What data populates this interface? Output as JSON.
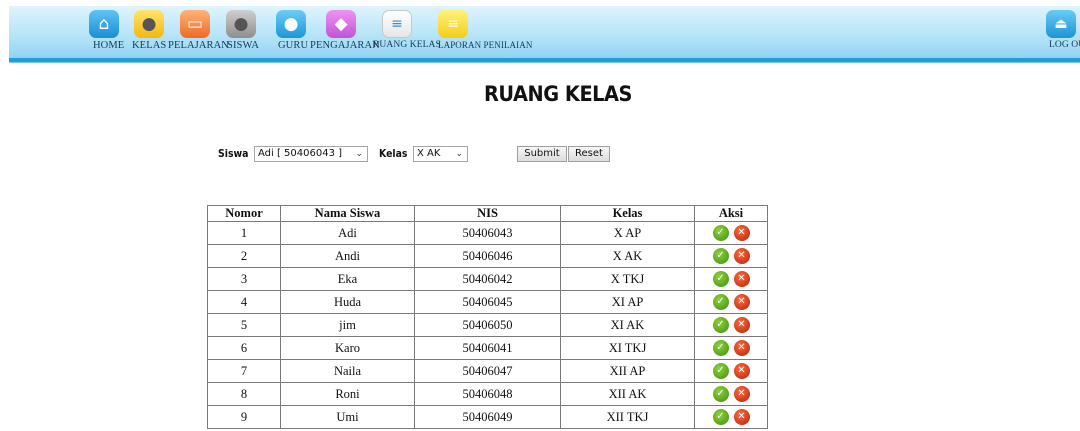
{
  "nav": {
    "items": [
      {
        "label": "HOME",
        "icon": "home-icon"
      },
      {
        "label": "KELAS",
        "icon": "user-icon"
      },
      {
        "label": "PELAJARAN",
        "icon": "book-icon"
      },
      {
        "label": "SISWA",
        "icon": "user-icon"
      },
      {
        "label": "GURU",
        "icon": "user-icon"
      },
      {
        "label": "PENGAJARAN",
        "icon": "graduation-cap-icon"
      },
      {
        "label": "RUANG KELAS",
        "icon": "list-icon"
      },
      {
        "label": "LAPORAN PENILAIAN",
        "icon": "notepad-icon"
      }
    ],
    "logout_label": "LOG OUT"
  },
  "page": {
    "title": "RUANG KELAS"
  },
  "filter": {
    "siswa_label": "Siswa",
    "siswa_value": "Adi [ 50406043 ]",
    "kelas_label": "Kelas",
    "kelas_value": "X AK",
    "submit_label": "Submit",
    "reset_label": "Reset"
  },
  "table": {
    "headers": [
      "Nomor",
      "Nama Siswa",
      "NIS",
      "Kelas",
      "Aksi"
    ],
    "rows": [
      [
        "1",
        "Adi",
        "50406043",
        "X AP"
      ],
      [
        "2",
        "Andi",
        "50406046",
        "X AK"
      ],
      [
        "3",
        "Eka",
        "50406042",
        "X TKJ"
      ],
      [
        "4",
        "Huda",
        "50406045",
        "XI AP"
      ],
      [
        "5",
        "jim",
        "50406050",
        "XI AK"
      ],
      [
        "6",
        "Karo",
        "50406041",
        "XI TKJ"
      ],
      [
        "7",
        "Naila",
        "50406047",
        "XII AP"
      ],
      [
        "8",
        "Roni",
        "50406048",
        "XII AK"
      ],
      [
        "9",
        "Umi",
        "50406049",
        "XII TKJ"
      ]
    ]
  }
}
